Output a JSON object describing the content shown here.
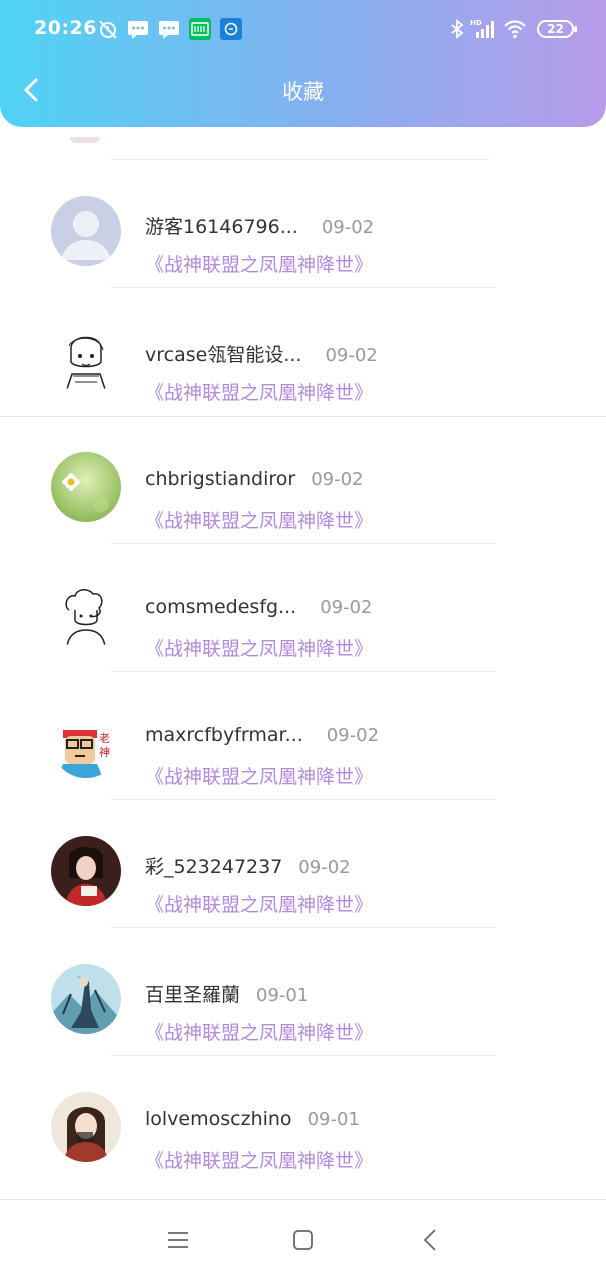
{
  "status_bar": {
    "time": "20:26",
    "battery": "22",
    "left_icons": [
      "alarm-off-icon",
      "message-icon",
      "message-icon",
      "iqiyi-app-icon",
      "app-icon"
    ],
    "right_icons": [
      "bluetooth-icon",
      "hd-signal-icon",
      "wifi-icon",
      "battery-icon"
    ]
  },
  "header": {
    "title": "收藏",
    "back_icon": "chevron-left-icon",
    "gradient": [
      "#4fd3f5",
      "#b89ce9"
    ]
  },
  "colors": {
    "link": "#b18adf",
    "date": "#999999",
    "name": "#333333"
  },
  "favorites": [
    {
      "user": "游客16146796...",
      "date": "09-02",
      "title": "《战神联盟之凤凰神降世》",
      "avatar": "default-avatar"
    },
    {
      "user": "vrcase瓴智能设...",
      "date": "09-02",
      "title": "《战神联盟之凤凰神降世》",
      "avatar": "sketch-girl-avatar"
    },
    {
      "user": "chbrigstiandiror",
      "date": "09-02",
      "title": "《战神联盟之凤凰神降世》",
      "avatar": "daisy-avatar"
    },
    {
      "user": "comsmedesfg...",
      "date": "09-02",
      "title": "《战神联盟之凤凰神降世》",
      "avatar": "sketch-boy-avatar"
    },
    {
      "user": "maxrcfbyfrmar...",
      "date": "09-02",
      "title": "《战神联盟之凤凰神降世》",
      "avatar": "cartoon-avatar"
    },
    {
      "user": "彩_523247237",
      "date": "09-02",
      "title": "《战神联盟之凤凰神降世》",
      "avatar": "photo-avatar"
    },
    {
      "user": "百里圣羅蘭",
      "date": "09-01",
      "title": "《战神联盟之凤凰神降世》",
      "avatar": "art-avatar"
    },
    {
      "user": "lolvemosczhino",
      "date": "09-01",
      "title": "《战神联盟之凤凰神降世》",
      "avatar": "photo-avatar"
    }
  ],
  "nav_bar": [
    "menu-icon",
    "home-icon",
    "back-icon"
  ]
}
